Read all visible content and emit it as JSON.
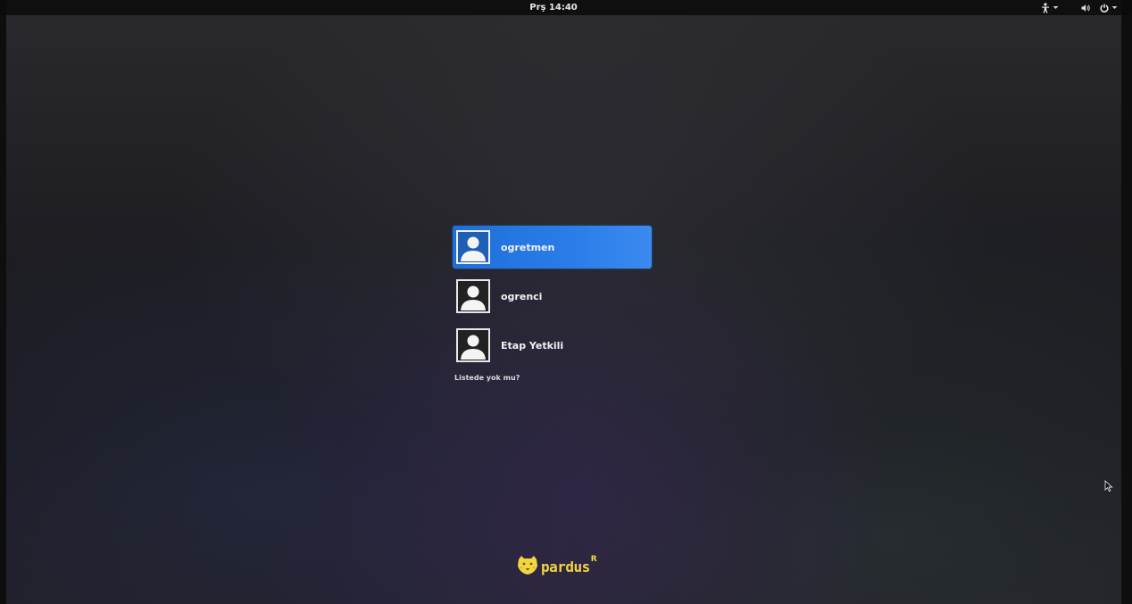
{
  "topbar": {
    "clock": "Prş 14:40",
    "accessibility_icon": "accessibility-icon",
    "volume_icon": "volume-icon",
    "power_icon": "power-icon",
    "dropdown_icon": "chevron-down-icon"
  },
  "users": [
    {
      "name": "ogretmen",
      "selected": true
    },
    {
      "name": "ogrenci",
      "selected": false
    },
    {
      "name": "Etap Yetkili",
      "selected": false
    }
  ],
  "not_listed": "Listede yok mu?",
  "logo": {
    "text": "pardus",
    "mark": "R",
    "color": "#f2d640"
  },
  "colors": {
    "selection": "#2a7de8",
    "topbar": "#0a0a0a"
  }
}
